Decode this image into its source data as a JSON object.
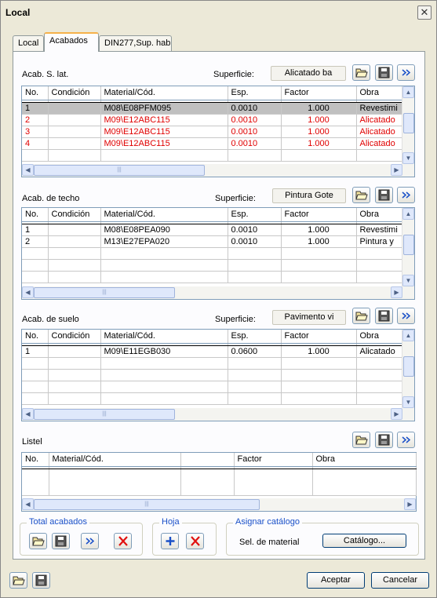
{
  "window": {
    "title": "Local",
    "close_glyph": "✕"
  },
  "tabs": [
    {
      "label": "Local"
    },
    {
      "label": "Acabados"
    },
    {
      "label": "DIN277,Sup. hab"
    }
  ],
  "superficie_label": "Superficie:",
  "sections": {
    "lat": {
      "title": "Acab. S. lat.",
      "superficie": "Alicatado ba",
      "columns": [
        "No.",
        "Condición",
        "Material/Cód.",
        "Esp.",
        "Factor",
        "Obra"
      ],
      "rows": [
        {
          "no": "1",
          "cond": "",
          "mat": "M08\\E08PFM095",
          "esp": "0.0010",
          "factor": "1.000",
          "obra": "Revestimi"
        },
        {
          "no": "2",
          "cond": "",
          "mat": "M09\\E12ABC115",
          "esp": "0.0010",
          "factor": "1.000",
          "obra": "Alicatado"
        },
        {
          "no": "3",
          "cond": "",
          "mat": "M09\\E12ABC115",
          "esp": "0.0010",
          "factor": "1.000",
          "obra": "Alicatado"
        },
        {
          "no": "4",
          "cond": "",
          "mat": "M09\\E12ABC115",
          "esp": "0.0010",
          "factor": "1.000",
          "obra": "Alicatado"
        }
      ]
    },
    "techo": {
      "title": "Acab. de techo",
      "superficie": "Pintura Gote",
      "columns": [
        "No.",
        "Condición",
        "Material/Cód.",
        "Esp.",
        "Factor",
        "Obra"
      ],
      "rows": [
        {
          "no": "1",
          "cond": "",
          "mat": "M08\\E08PEA090",
          "esp": "0.0010",
          "factor": "1.000",
          "obra": "Revestimi"
        },
        {
          "no": "2",
          "cond": "",
          "mat": "M13\\E27EPA020",
          "esp": "0.0010",
          "factor": "1.000",
          "obra": "Pintura y"
        }
      ]
    },
    "suelo": {
      "title": "Acab. de suelo",
      "superficie": "Pavimento vi",
      "columns": [
        "No.",
        "Condición",
        "Material/Cód.",
        "Esp.",
        "Factor",
        "Obra"
      ],
      "rows": [
        {
          "no": "1",
          "cond": "",
          "mat": "M09\\E11EGB030",
          "esp": "0.0600",
          "factor": "1.000",
          "obra": "Alicatado"
        }
      ]
    },
    "listel": {
      "title": "Listel",
      "columns": [
        "No.",
        "Material/Cód.",
        "",
        "Factor",
        "Obra"
      ]
    }
  },
  "groups": {
    "total": {
      "title": "Total acabados"
    },
    "hoja": {
      "title": "Hoja"
    },
    "catalogo": {
      "title": "Asignar catálogo",
      "label": "Sel. de material",
      "button": "Catálogo..."
    }
  },
  "footer": {
    "accept": "Aceptar",
    "cancel": "Cancelar"
  },
  "colors": {
    "selected_row": "#c0c0c0",
    "red_row": "#e00000",
    "group_title": "#1a50c8",
    "tab_highlight": "#f6b14a"
  },
  "icons": [
    "folder-open-icon",
    "save-disk-icon",
    "double-chevron-right-icon",
    "plus-icon",
    "red-x-icon",
    "close-icon"
  ]
}
